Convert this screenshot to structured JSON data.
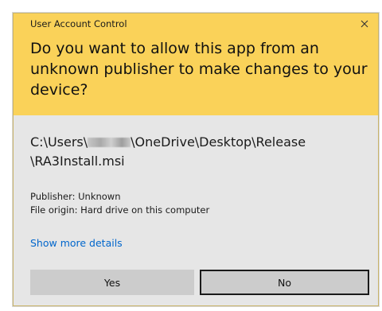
{
  "window": {
    "title": "User Account Control",
    "close_icon": "close-icon"
  },
  "prompt": {
    "question": "Do you want to allow this app from an unknown publisher to make changes to your device?"
  },
  "app": {
    "path_prefix": "C:\\Users\\",
    "path_suffix": "\\OneDrive\\Desktop\\Release",
    "path_line2": "\\RA3Install.msi",
    "publisher": "Publisher: Unknown",
    "file_origin": "File origin: Hard drive on this computer"
  },
  "links": {
    "show_more": "Show more details"
  },
  "buttons": {
    "yes": "Yes",
    "no": "No"
  },
  "colors": {
    "header_bg": "#fad259",
    "body_bg": "#e6e6e6",
    "link": "#0066cc",
    "button_bg": "#cccccc"
  }
}
